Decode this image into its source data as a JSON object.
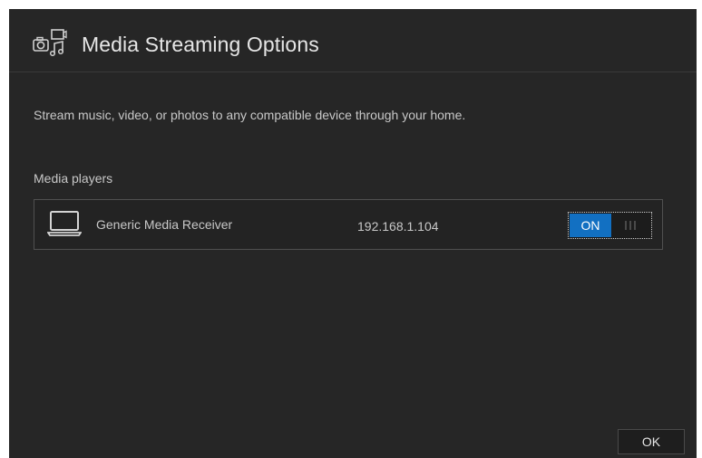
{
  "dialog": {
    "title": "Media Streaming Options",
    "header_icon": "media-streaming-icon",
    "description": "Stream music, video, or photos to any compatible device through your home."
  },
  "media_players": {
    "label": "Media players",
    "items": [
      {
        "icon": "laptop-icon",
        "name": "Generic Media Receiver",
        "ip": "192.168.1.104",
        "toggle_label": "ON",
        "enabled": true
      }
    ]
  },
  "footer": {
    "ok_label": "OK"
  },
  "colors": {
    "background": "#262626",
    "toggle_on": "#1270c2",
    "text": "#c8c8c8"
  }
}
